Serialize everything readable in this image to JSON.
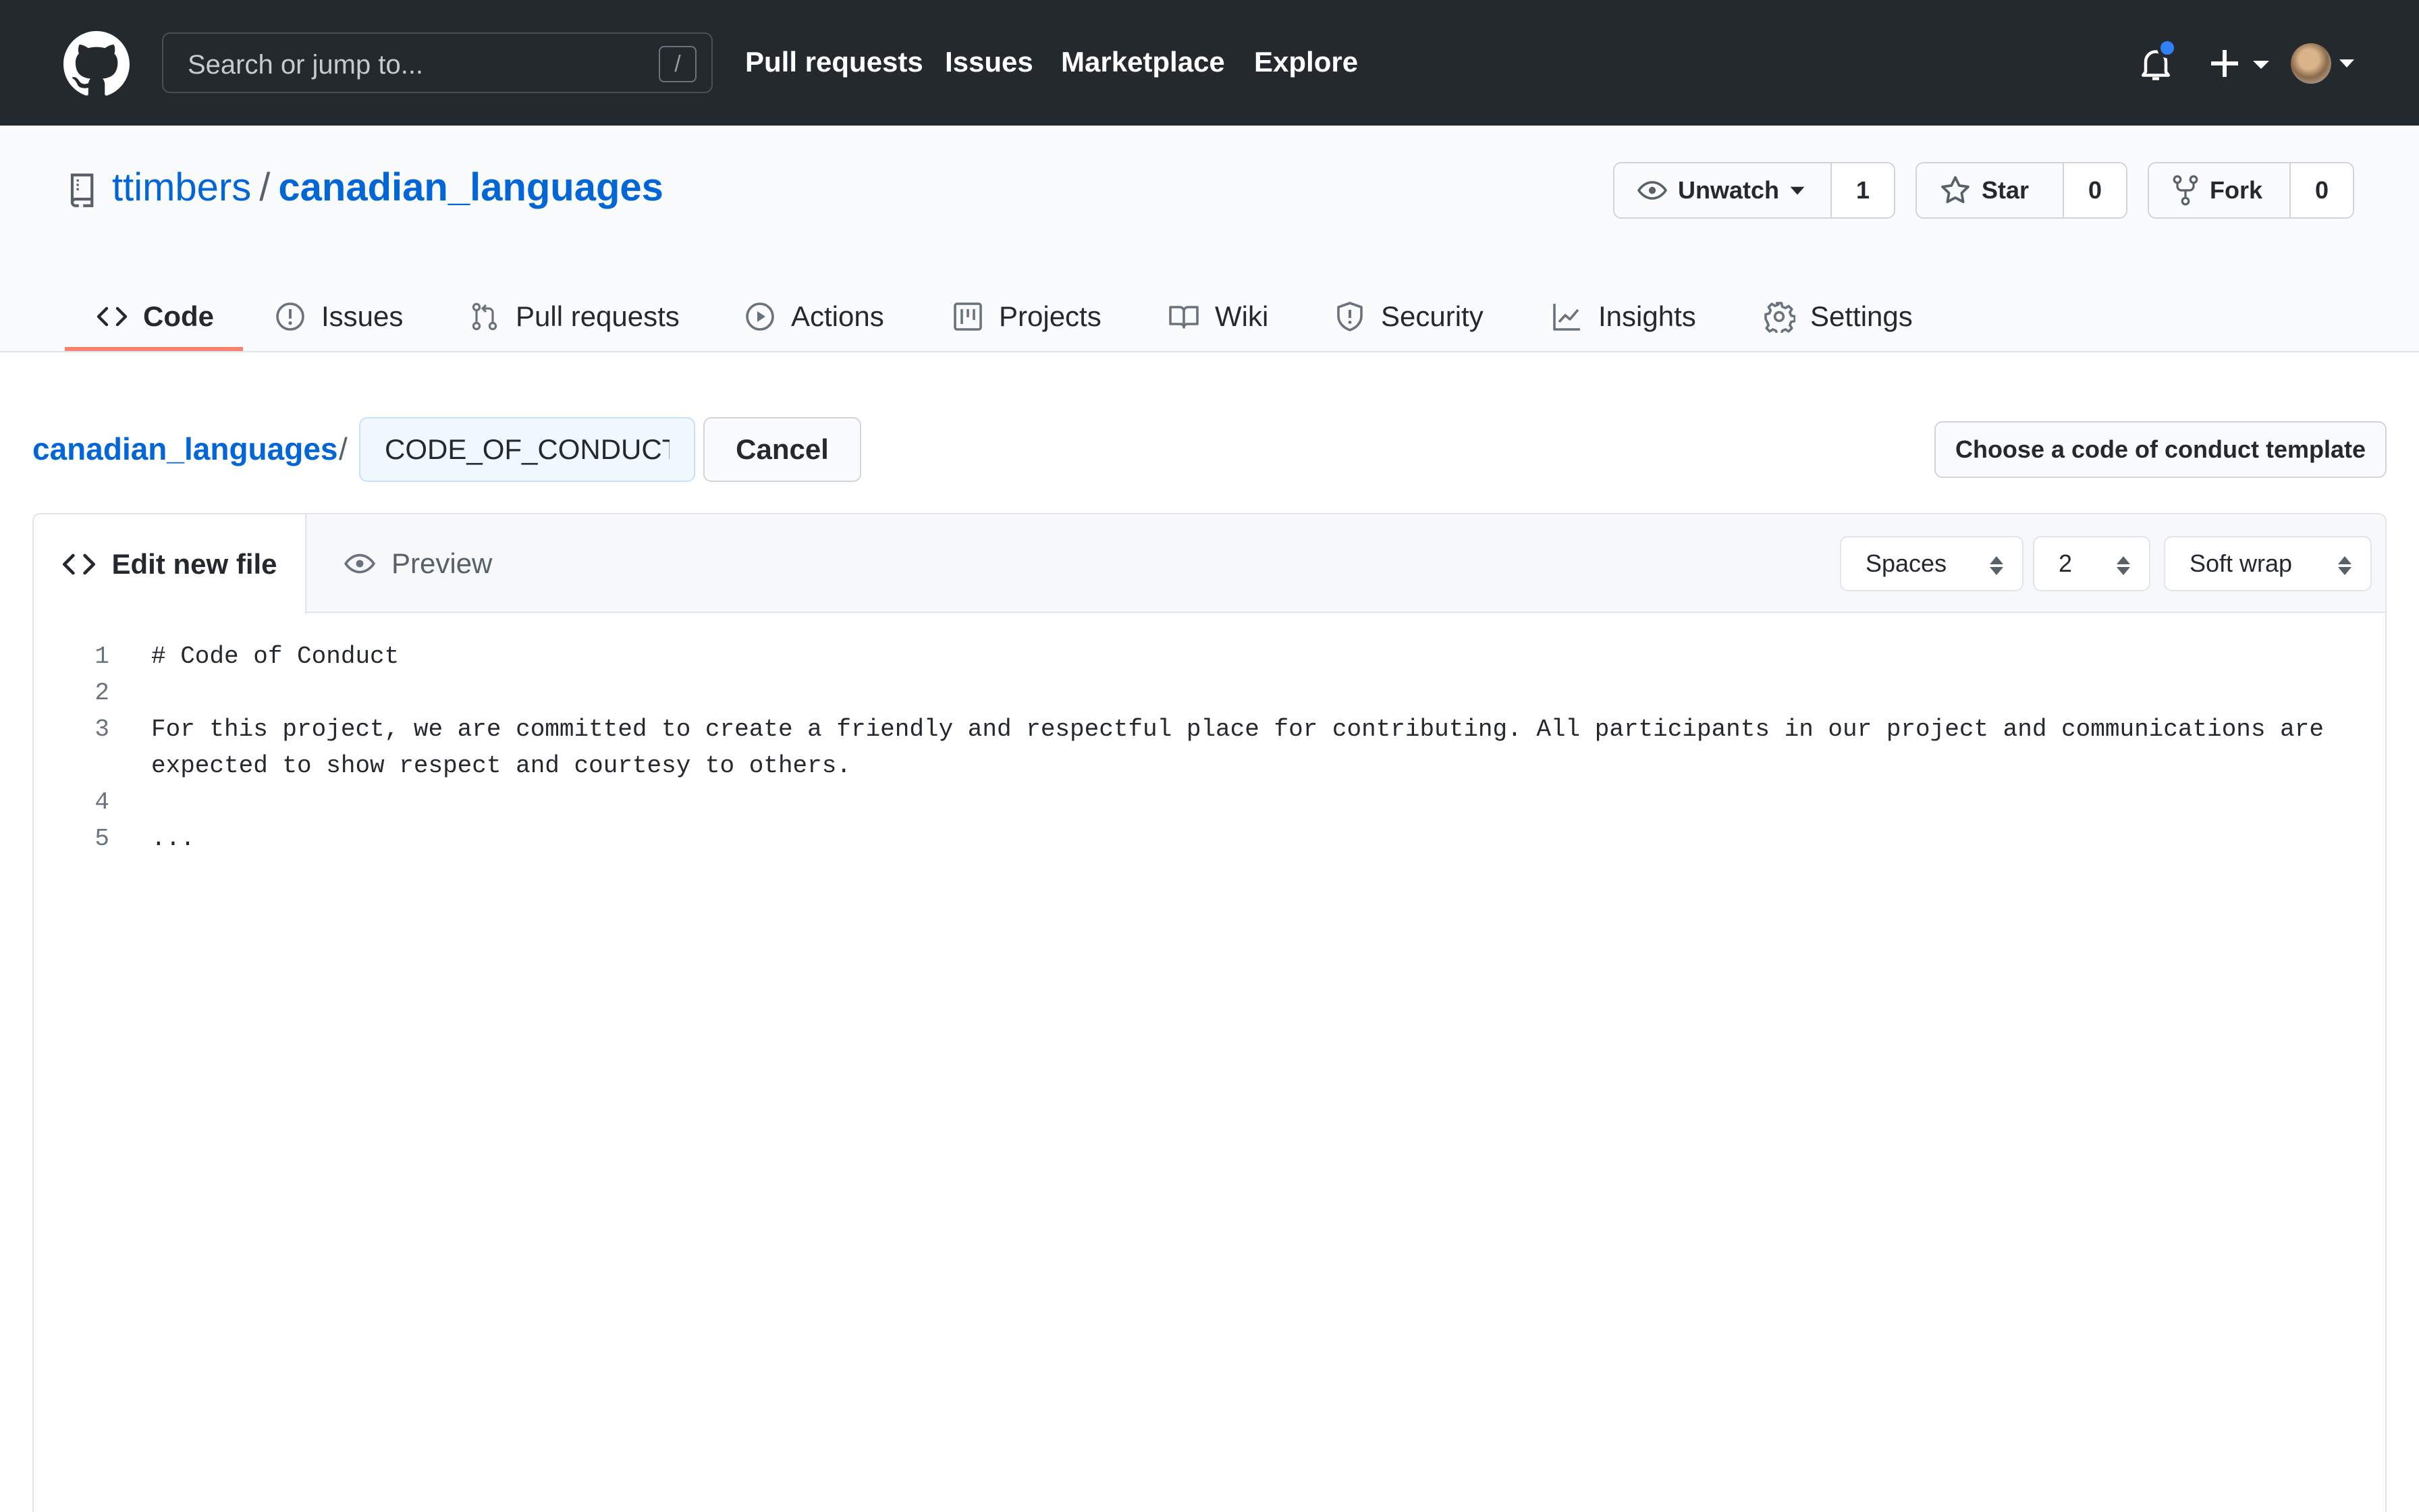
{
  "header": {
    "search_placeholder": "Search or jump to...",
    "search_key": "/",
    "nav": [
      "Pull requests",
      "Issues",
      "Marketplace",
      "Explore"
    ]
  },
  "repo": {
    "owner": "ttimbers",
    "separator": "/",
    "name": "canadian_languages",
    "watch_label": "Unwatch",
    "watch_count": "1",
    "star_label": "Star",
    "star_count": "0",
    "fork_label": "Fork",
    "fork_count": "0"
  },
  "tabs": [
    {
      "label": "Code",
      "icon": "code-icon",
      "selected": true
    },
    {
      "label": "Issues",
      "icon": "issue-icon"
    },
    {
      "label": "Pull requests",
      "icon": "pull-request-icon"
    },
    {
      "label": "Actions",
      "icon": "play-icon"
    },
    {
      "label": "Projects",
      "icon": "project-icon"
    },
    {
      "label": "Wiki",
      "icon": "book-icon"
    },
    {
      "label": "Security",
      "icon": "shield-icon"
    },
    {
      "label": "Insights",
      "icon": "graph-icon"
    },
    {
      "label": "Settings",
      "icon": "gear-icon"
    }
  ],
  "editor": {
    "breadcrumb_repo": "canadian_languages",
    "breadcrumb_sep": "/",
    "filename": "CODE_OF_CONDUCT.md",
    "cancel_label": "Cancel",
    "template_label": "Choose a code of conduct template",
    "edit_tab": "Edit new file",
    "preview_tab": "Preview",
    "indent_mode": "Spaces",
    "indent_size": "2",
    "wrap_mode": "Soft wrap",
    "lines": [
      {
        "num": "1",
        "text": "# Code of Conduct"
      },
      {
        "num": "2",
        "text": ""
      },
      {
        "num": "3",
        "text": "For this project, we are committed to create a friendly and respectful place for contributing. All participants in our project and communications are expected to show respect and courtesy to others."
      },
      {
        "num": "4",
        "text": ""
      },
      {
        "num": "5",
        "text": "..."
      }
    ]
  },
  "colors": {
    "header_bg": "#24292e",
    "link": "#0366d6",
    "tab_underline": "#f9826c",
    "notification_dot": "#2f81f7"
  }
}
